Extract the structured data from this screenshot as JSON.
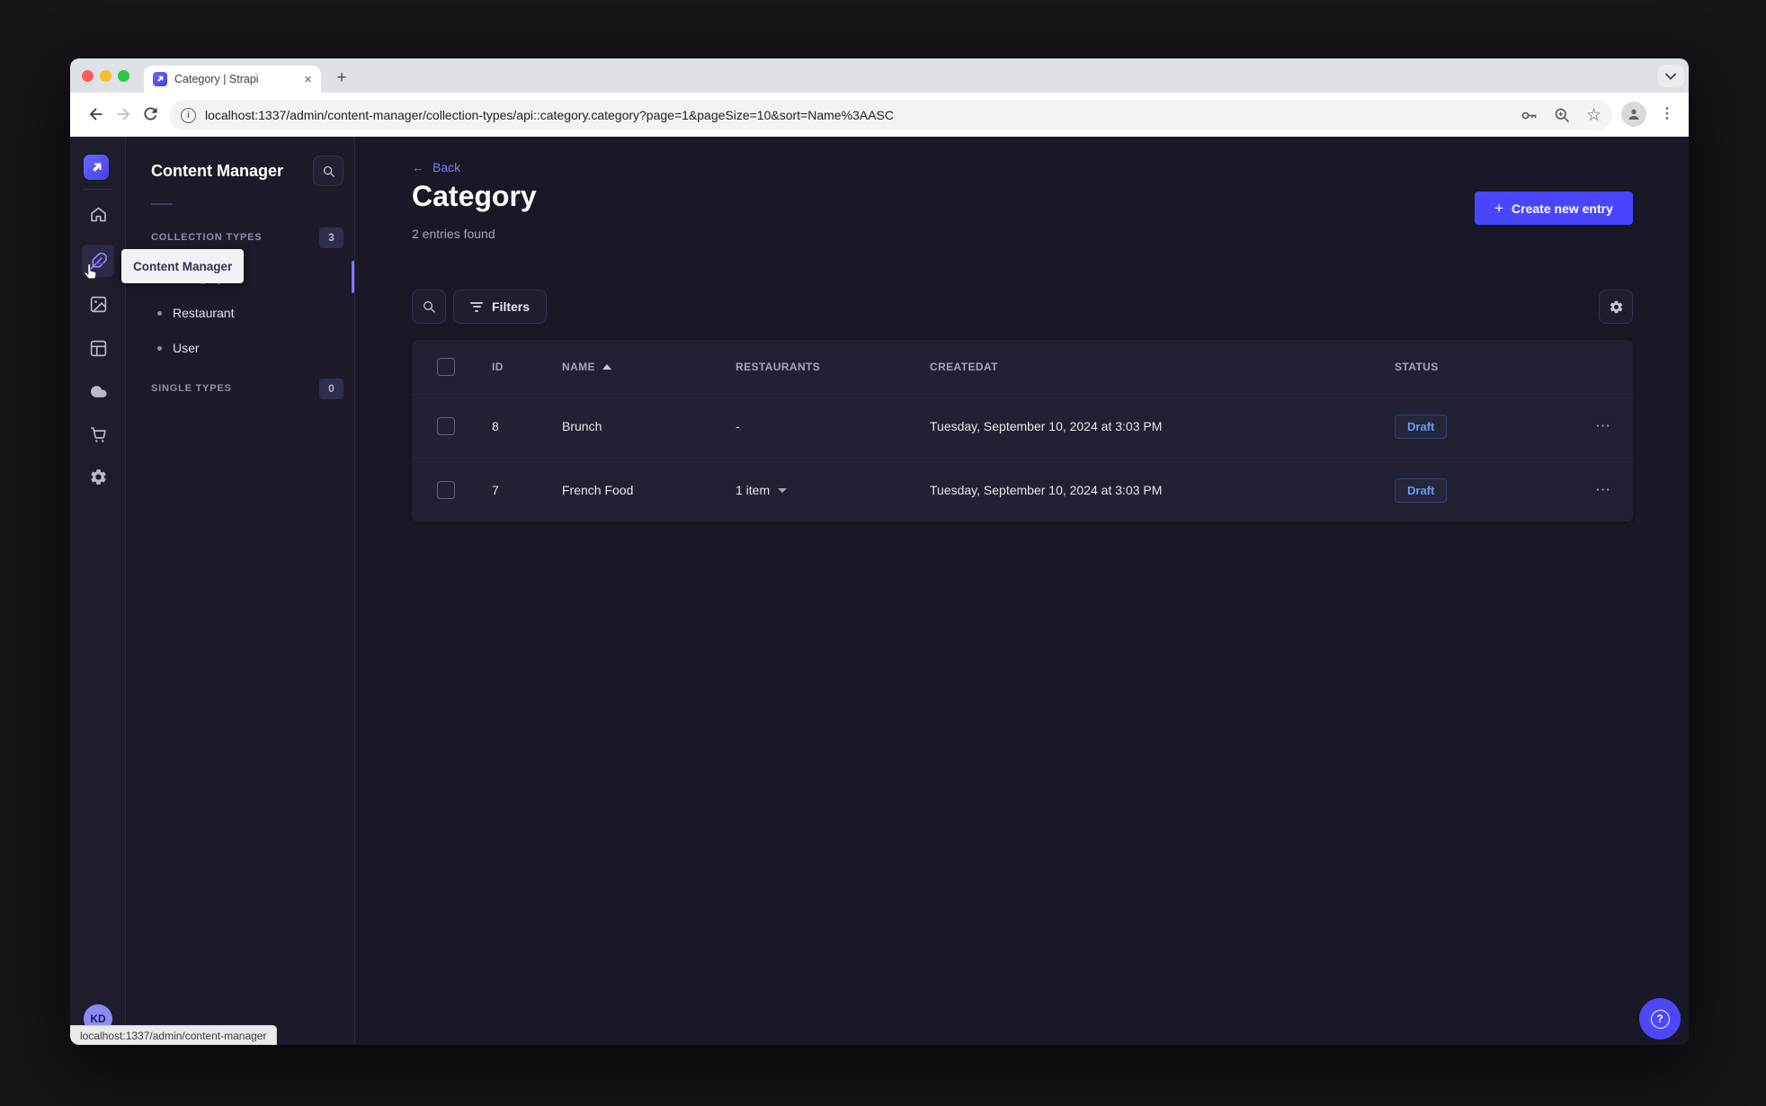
{
  "browser": {
    "tab_title": "Category | Strapi",
    "url": "localhost:1337/admin/content-manager/collection-types/api::category.category?page=1&pageSize=10&sort=Name%3AASC",
    "status_bubble": "localhost:1337/admin/content-manager"
  },
  "icons": {
    "close": "×",
    "plus": "+",
    "ellipsis_h": "⋯",
    "ellipsis_v": "⋮",
    "star": "☆",
    "back_arrow": "←",
    "chevron_down": "⌄",
    "question": "?",
    "info": "i"
  },
  "sidebar": {
    "tooltip": "Content Manager",
    "avatar": "KD",
    "icons": [
      "strapi-logo",
      "home",
      "content-manager",
      "media-library",
      "content-type-builder",
      "cloud",
      "marketplace",
      "settings"
    ]
  },
  "subnav": {
    "title": "Content Manager",
    "sections": [
      {
        "label": "COLLECTION TYPES",
        "count": "3",
        "items": [
          {
            "label": "Category"
          },
          {
            "label": "Restaurant"
          },
          {
            "label": "User"
          }
        ]
      },
      {
        "label": "SINGLE TYPES",
        "count": "0",
        "items": []
      }
    ]
  },
  "main": {
    "back_label": "Back",
    "title": "Category",
    "subtitle": "2 entries found",
    "create_button": "Create new entry",
    "filters_button": "Filters",
    "table": {
      "headers": {
        "id": "ID",
        "name": "NAME",
        "restaurants": "RESTAURANTS",
        "createdat": "CREATEDAT",
        "status": "STATUS"
      },
      "rows": [
        {
          "id": "8",
          "name": "Brunch",
          "restaurants": "-",
          "createdat": "Tuesday, September 10, 2024 at 3:03 PM",
          "status": "Draft"
        },
        {
          "id": "7",
          "name": "French Food",
          "restaurants": "1 item",
          "createdat": "Tuesday, September 10, 2024 at 3:03 PM",
          "status": "Draft"
        }
      ]
    }
  },
  "colors": {
    "primary": "#4945ff",
    "primary_light": "#7b79ff",
    "app_bg": "#181826",
    "card_bg": "#212134",
    "draft_text": "#699df0"
  }
}
